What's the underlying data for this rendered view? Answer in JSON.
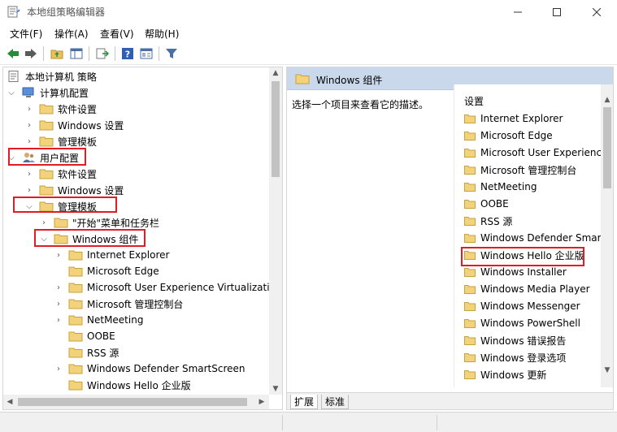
{
  "window": {
    "title": "本地组策略编辑器",
    "min_label": "—",
    "max_label": "☐",
    "close_label": "✕"
  },
  "menu": {
    "file": "文件(F)",
    "action": "操作(A)",
    "view": "查看(V)",
    "help": "帮助(H)"
  },
  "toolbar": {
    "icons": [
      "back-icon",
      "forward-icon",
      "up-folder-icon",
      "show-hide-tree-icon",
      "export-list-icon",
      "help-icon",
      "properties-icon",
      "filter-icon"
    ]
  },
  "tree": {
    "root": "本地计算机 策略",
    "computer_config": "计算机配置",
    "cc_software": "软件设置",
    "cc_windows": "Windows 设置",
    "cc_admin": "管理模板",
    "user_config": "用户配置",
    "uc_software": "软件设置",
    "uc_windows": "Windows 设置",
    "uc_admin": "管理模板",
    "start_menu": "\"开始\"菜单和任务栏",
    "windows_components": "Windows 组件",
    "children": [
      "Internet Explorer",
      "Microsoft Edge",
      "Microsoft User Experience Virtualizatic",
      "Microsoft 管理控制台",
      "NetMeeting",
      "OOBE",
      "RSS 源",
      "Windows Defender SmartScreen",
      "Windows Hello 企业版"
    ]
  },
  "details": {
    "header": "Windows 组件",
    "description": "选择一个项目来查看它的描述。",
    "column_header": "设置",
    "items": [
      "Internet Explorer",
      "Microsoft Edge",
      "Microsoft User Experience",
      "Microsoft 管理控制台",
      "NetMeeting",
      "OOBE",
      "RSS 源",
      "Windows Defender Smart",
      "Windows Hello 企业版",
      "Windows Installer",
      "Windows Media Player",
      "Windows Messenger",
      "Windows PowerShell",
      "Windows 错误报告",
      "Windows 登录选项",
      "Windows 更新"
    ],
    "tab_extended": "扩展",
    "tab_standard": "标准"
  },
  "colors": {
    "highlight_box": "#e31b23",
    "folder": "#e8c158",
    "header_bg": "#c9d8ea"
  }
}
